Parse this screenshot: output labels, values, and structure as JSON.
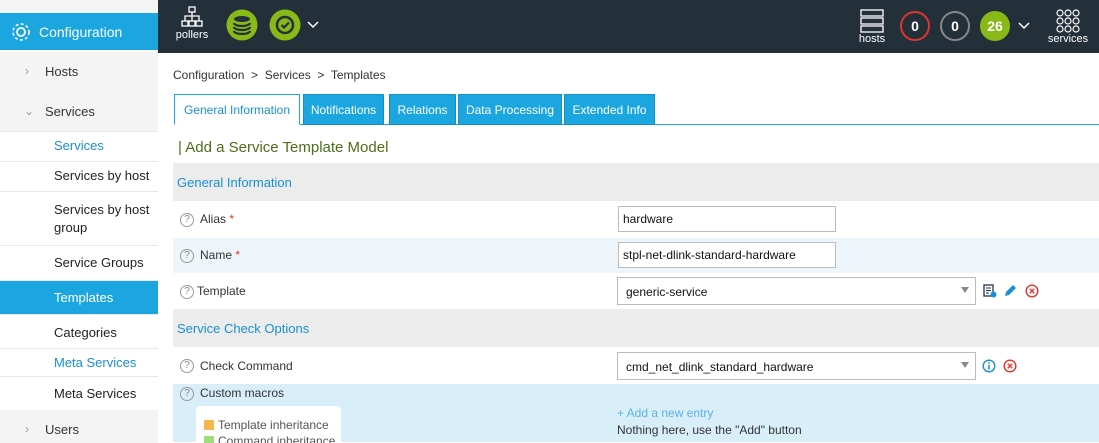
{
  "topbar": {
    "pollers_label": "pollers",
    "hosts_label": "hosts",
    "services_label": "services",
    "status_counts": [
      "0",
      "0",
      "26"
    ],
    "status_colors": [
      "#e0342f",
      "#888888",
      "#88b917"
    ]
  },
  "sidebar": {
    "config_label": "Configuration",
    "l1": [
      {
        "label": "Hosts"
      },
      {
        "label": "Services"
      },
      {
        "label": "Users"
      }
    ],
    "l2": [
      {
        "label": "Services"
      },
      {
        "label": "Services by host"
      },
      {
        "label": "Services by host group"
      },
      {
        "label": "Service Groups"
      },
      {
        "label": "Templates"
      },
      {
        "label": "Categories"
      },
      {
        "label": "Meta Services"
      },
      {
        "label": "Meta Services"
      }
    ]
  },
  "breadcrumb": "Configuration  >  Services  >  Templates",
  "tabs": [
    "General Information",
    "Notifications",
    "Relations",
    "Data Processing",
    "Extended Info"
  ],
  "form": {
    "title": "| Add a Service Template Model",
    "sections": [
      "General Information",
      "Service Check Options"
    ],
    "alias_label": "Alias",
    "alias_value": "hardware",
    "name_label": "Name",
    "name_value": "stpl-net-dlink-standard-hardware",
    "template_label": "Template",
    "template_value": "generic-service",
    "check_command_label": "Check Command",
    "check_command_value": "cmd_net_dlink_standard_hardware",
    "custom_macros_label": "Custom macros",
    "required_mark": "*",
    "help_glyph": "?",
    "add_entry": "+ Add a new entry",
    "empty_msg": "Nothing here, use the \"Add\" button",
    "legend": [
      "Template inheritance",
      "Command inheritance"
    ],
    "legend_colors": [
      "#f5b64a",
      "#9fdc7a"
    ]
  },
  "colors": {
    "accent": "#1ba6e0",
    "topbar": "#232f39",
    "title_green": "#4d6e19"
  }
}
